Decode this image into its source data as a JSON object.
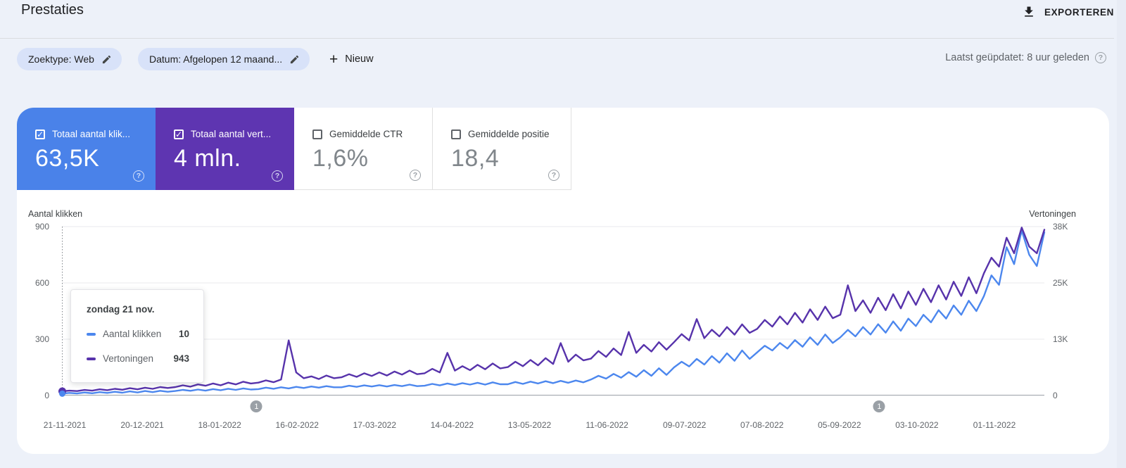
{
  "header": {
    "title": "Prestaties",
    "export_label": "EXPORTEREN"
  },
  "filters": {
    "chips": [
      {
        "label": "Zoektype: Web"
      },
      {
        "label": "Datum: Afgelopen 12 maand..."
      }
    ],
    "new_label": "Nieuw",
    "updated": "Laatst geüpdatet: 8 uur geleden"
  },
  "metrics": [
    {
      "label": "Totaal aantal klik...",
      "value": "63,5K",
      "checked": true,
      "bg": "#4a82e9"
    },
    {
      "label": "Totaal aantal vert...",
      "value": "4 mln.",
      "checked": true,
      "bg": "#5e35b1"
    },
    {
      "label": "Gemiddelde CTR",
      "value": "1,6%",
      "checked": false,
      "bg": "#ffffff"
    },
    {
      "label": "Gemiddelde positie",
      "value": "18,4",
      "checked": false,
      "bg": "#ffffff"
    }
  ],
  "tooltip": {
    "title": "zondag 21 nov.",
    "rows": [
      {
        "label": "Aantal klikken",
        "value": "10",
        "color": "#4c87ee"
      },
      {
        "label": "Vertoningen",
        "value": "943",
        "color": "#5733ab"
      }
    ]
  },
  "chart_data": {
    "type": "line",
    "title": "Prestaties - klikken en vertoningen per dag",
    "y_left": {
      "label": "Aantal klikken",
      "ticks": [
        "900",
        "600",
        "300",
        "0"
      ],
      "max": 900
    },
    "y_right": {
      "label": "Vertoningen",
      "ticks": [
        "38K",
        "25K",
        "13K",
        "0"
      ],
      "max": 38000
    },
    "grid_fractions": [
      0,
      0.3333,
      0.6667
    ],
    "x_labels": [
      "21-11-2021",
      "20-12-2021",
      "18-01-2022",
      "16-02-2022",
      "17-03-2022",
      "14-04-2022",
      "13-05-2022",
      "11-06-2022",
      "09-07-2022",
      "07-08-2022",
      "05-09-2022",
      "03-10-2022",
      "01-11-2022"
    ],
    "annotations": [
      {
        "label": "1",
        "x_frac": 0.198
      },
      {
        "label": "1",
        "x_frac": 0.832
      }
    ],
    "hover_index": 0,
    "series": [
      {
        "name": "Aantal klikken",
        "axis": "left",
        "color": "#4c87ee",
        "values": [
          10,
          14,
          11,
          16,
          12,
          18,
          14,
          20,
          15,
          22,
          16,
          24,
          18,
          25,
          20,
          24,
          30,
          25,
          32,
          26,
          34,
          28,
          36,
          30,
          38,
          32,
          34,
          42,
          36,
          44,
          38,
          46,
          40,
          48,
          42,
          50,
          44,
          44,
          52,
          46,
          54,
          48,
          55,
          48,
          56,
          50,
          58,
          50,
          52,
          62,
          54,
          64,
          56,
          66,
          58,
          68,
          58,
          70,
          60,
          60,
          72,
          62,
          74,
          64,
          76,
          66,
          78,
          68,
          80,
          70,
          85,
          105,
          90,
          115,
          95,
          125,
          100,
          135,
          105,
          145,
          110,
          150,
          180,
          155,
          195,
          165,
          210,
          175,
          225,
          185,
          240,
          195,
          230,
          265,
          240,
          280,
          250,
          295,
          260,
          310,
          270,
          325,
          280,
          310,
          350,
          315,
          365,
          325,
          380,
          335,
          395,
          345,
          410,
          370,
          430,
          390,
          455,
          410,
          480,
          430,
          505,
          450,
          530,
          640,
          590,
          790,
          700,
          880,
          750,
          690,
          870
        ]
      },
      {
        "name": "Vertoningen",
        "axis": "right",
        "color": "#5733ab",
        "values": [
          943,
          1100,
          1000,
          1250,
          1100,
          1400,
          1200,
          1500,
          1300,
          1650,
          1400,
          1750,
          1500,
          1900,
          1700,
          1900,
          2300,
          2000,
          2500,
          2200,
          2700,
          2300,
          2900,
          2500,
          3100,
          2700,
          2900,
          3400,
          3000,
          3600,
          12400,
          5200,
          3900,
          4300,
          3700,
          4500,
          3900,
          4100,
          4800,
          4200,
          5000,
          4400,
          5200,
          4500,
          5400,
          4700,
          5600,
          4800,
          5000,
          6000,
          5200,
          9600,
          5600,
          6600,
          5700,
          6900,
          5900,
          7200,
          6100,
          6400,
          7600,
          6600,
          8000,
          6800,
          8400,
          7100,
          11800,
          7600,
          9200,
          7900,
          8300,
          10000,
          8700,
          10600,
          9100,
          14300,
          9600,
          11400,
          9900,
          12000,
          10300,
          12000,
          13800,
          12400,
          17200,
          12900,
          14800,
          13300,
          15400,
          13700,
          16000,
          14100,
          15000,
          17000,
          15500,
          17800,
          16000,
          18600,
          16400,
          19400,
          17000,
          20000,
          17400,
          18200,
          24800,
          19000,
          21400,
          18600,
          22000,
          19200,
          22800,
          19600,
          23400,
          20400,
          24000,
          21000,
          24800,
          21600,
          25600,
          22400,
          26600,
          23000,
          27500,
          31000,
          29000,
          35500,
          32000,
          37800,
          33500,
          32000,
          37300
        ]
      }
    ]
  }
}
